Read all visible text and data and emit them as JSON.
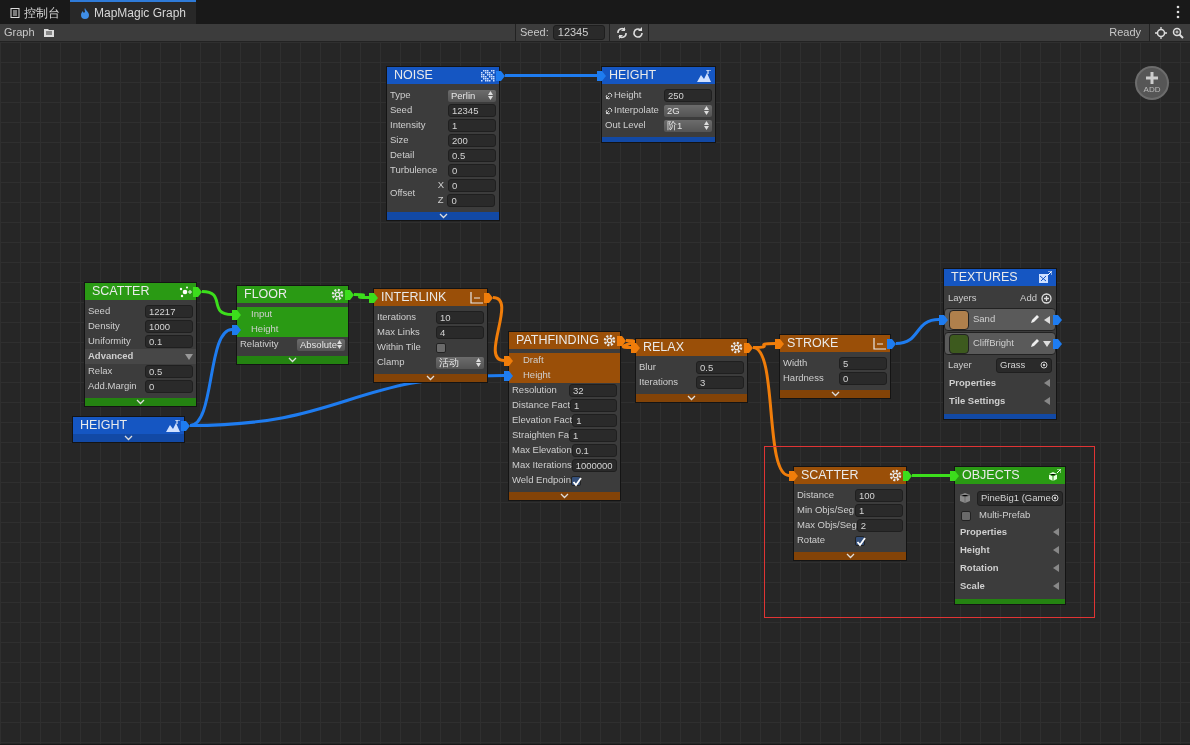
{
  "tabs": [
    {
      "label": "控制台",
      "selected": false
    },
    {
      "label": "MapMagic Graph",
      "selected": true
    }
  ],
  "toolbar": {
    "graph_label": "Graph",
    "seed_label": "Seed:",
    "seed_value": "12345",
    "status": "Ready"
  },
  "add_button": {
    "label": "ADD"
  },
  "nodes": [
    {
      "title": "NOISE",
      "color": "#1556c2",
      "expandable": true,
      "rows": [
        {
          "kind": "select",
          "label": "Type",
          "value": "Perlin"
        },
        {
          "kind": "field",
          "label": "Seed",
          "value": "12345"
        },
        {
          "kind": "field",
          "label": "Intensity",
          "value": "1"
        },
        {
          "kind": "field",
          "label": "Size",
          "value": "200"
        },
        {
          "kind": "field",
          "label": "Detail",
          "value": "0.5"
        },
        {
          "kind": "field",
          "label": "Turbulence",
          "value": "0"
        },
        {
          "kind": "vector",
          "label": "Offset",
          "components": [
            {
              "axis": "X",
              "value": "0"
            },
            {
              "axis": "Z",
              "value": "0"
            }
          ]
        }
      ]
    },
    {
      "title": "HEIGHT",
      "color": "#1556c2",
      "expandable": false,
      "rows": [
        {
          "kind": "field",
          "label": "Height",
          "value": "250",
          "linked": true
        },
        {
          "kind": "select",
          "label": "Interpolate",
          "value": "2G",
          "linked": true
        },
        {
          "kind": "select",
          "label": "Out Level",
          "value": "阶1",
          "linked": false
        }
      ]
    },
    {
      "title": "SCATTER",
      "color": "#2a9a14",
      "expandable": true,
      "rows": [
        {
          "kind": "field",
          "label": "Seed",
          "value": "12217"
        },
        {
          "kind": "field",
          "label": "Density",
          "value": "1000"
        },
        {
          "kind": "field",
          "label": "Uniformity",
          "value": "0.1"
        },
        {
          "kind": "section",
          "label": "Advanced",
          "expanded": true
        },
        {
          "kind": "field",
          "label": "Relax",
          "value": "0.5"
        },
        {
          "kind": "field",
          "label": "Add.Margin",
          "value": "0"
        }
      ]
    },
    {
      "title": "FLOOR",
      "color": "#2a9a14",
      "expandable": true,
      "rows": [
        {
          "kind": "port",
          "label": "Input",
          "color": "#3cde1c"
        },
        {
          "kind": "port",
          "label": "Height",
          "color": "#1e7cf0"
        },
        {
          "kind": "select",
          "label": "Relativity",
          "value": "Absolute"
        }
      ]
    },
    {
      "title": "HEIGHT",
      "color": "#1556c2",
      "expandable": true
    },
    {
      "title": "INTERLINK",
      "color": "#9a4f08",
      "expandable": true,
      "rows": [
        {
          "kind": "field",
          "label": "Iterations",
          "value": "10"
        },
        {
          "kind": "field",
          "label": "Max Links",
          "value": "4"
        },
        {
          "kind": "checkbox",
          "label": "Within Tile",
          "checked": false
        },
        {
          "kind": "select",
          "label": "Clamp",
          "value": "活动"
        }
      ]
    },
    {
      "title": "PATHFINDING",
      "color": "#9a4f08",
      "expandable": true,
      "rows": [
        {
          "kind": "port",
          "label": "Draft",
          "color": "#f07d0a"
        },
        {
          "kind": "port",
          "label": "Height",
          "color": "#1e7cf0"
        },
        {
          "kind": "field",
          "label": "Resolution",
          "value": "32"
        },
        {
          "kind": "field",
          "label": "Distance Fact",
          "value": "1"
        },
        {
          "kind": "field",
          "label": "Elevation Fact",
          "value": "1"
        },
        {
          "kind": "field",
          "label": "Straighten Fa",
          "value": "1"
        },
        {
          "kind": "field",
          "label": "Max Elevation",
          "value": "0.1"
        },
        {
          "kind": "field",
          "label": "Max Iterations",
          "value": "1000000"
        },
        {
          "kind": "checkbox",
          "label": "Weld Endpoin",
          "checked": true
        }
      ]
    },
    {
      "title": "RELAX",
      "color": "#9a4f08",
      "expandable": true,
      "rows": [
        {
          "kind": "field",
          "label": "Blur",
          "value": "0.5"
        },
        {
          "kind": "field",
          "label": "Iterations",
          "value": "3"
        }
      ]
    },
    {
      "title": "STROKE",
      "color": "#9a4f08",
      "expandable": true,
      "rows": [
        {
          "kind": "field",
          "label": "Width",
          "value": "5"
        },
        {
          "kind": "field",
          "label": "Hardness",
          "value": "0"
        }
      ]
    },
    {
      "title": "TEXTURES",
      "color": "#1556c2",
      "expandable": false,
      "rows": [
        {
          "kind": "layers_header",
          "label": "Layers",
          "add": "Add"
        },
        {
          "kind": "layer",
          "label": "Sand",
          "color": "#b0804c",
          "expanded": false
        },
        {
          "kind": "layer",
          "label": "CliffBright",
          "color": "#3d5a1e",
          "expanded": true
        },
        {
          "kind": "object",
          "label": "Layer",
          "value": "Grass"
        },
        {
          "kind": "foldout",
          "label": "Properties"
        },
        {
          "kind": "foldout",
          "label": "Tile Settings"
        }
      ]
    },
    {
      "title": "SCATTER",
      "color": "#9a4f08",
      "expandable": true,
      "rows": [
        {
          "kind": "field",
          "label": "Distance",
          "value": "100"
        },
        {
          "kind": "field",
          "label": "Min Objs/Seg",
          "value": "1"
        },
        {
          "kind": "field",
          "label": "Max Objs/Seg",
          "value": "2"
        },
        {
          "kind": "checkbox",
          "label": "Rotate",
          "checked": true
        }
      ]
    },
    {
      "title": "OBJECTS",
      "color": "#2a9a14",
      "expandable": false,
      "rows": [
        {
          "kind": "prefab",
          "value": "PineBig1 (Game"
        },
        {
          "kind": "check_left",
          "label": "Multi-Prefab",
          "checked": false
        },
        {
          "kind": "foldout",
          "label": "Properties"
        },
        {
          "kind": "foldout",
          "label": "Height"
        },
        {
          "kind": "foldout",
          "label": "Rotation"
        },
        {
          "kind": "foldout",
          "label": "Scale"
        }
      ]
    }
  ]
}
